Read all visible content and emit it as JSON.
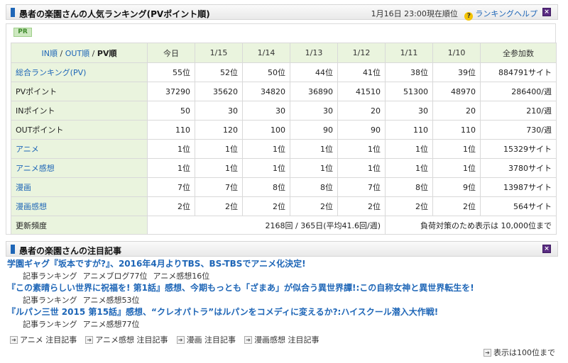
{
  "ranking_panel": {
    "title": "愚者の楽園さんの人気ランキング(PVポイント順)",
    "as_of": "1月16日 23:00現在順位",
    "help_label": "ランキングヘルプ",
    "close_glyph": "×",
    "help_glyph": "?",
    "pr_label": "PR"
  },
  "table": {
    "sort_in": "IN順",
    "sort_out": "OUT順",
    "sort_pv": "PV順",
    "sep": "/",
    "columns": [
      "今日",
      "1/15",
      "1/14",
      "1/13",
      "1/12",
      "1/11",
      "1/10",
      "全参加数"
    ],
    "rows": [
      {
        "label": "総合ランキング(PV)",
        "values": [
          "55位",
          "52位",
          "50位",
          "44位",
          "41位",
          "38位",
          "39位",
          "884791サイト"
        ]
      },
      {
        "label": "PVポイント",
        "values": [
          "37290",
          "35620",
          "34820",
          "36890",
          "41510",
          "51300",
          "48970",
          "286400/週"
        ]
      },
      {
        "label": "INポイント",
        "values": [
          "50",
          "30",
          "30",
          "30",
          "20",
          "30",
          "20",
          "210/週"
        ]
      },
      {
        "label": "OUTポイント",
        "values": [
          "110",
          "120",
          "100",
          "90",
          "90",
          "110",
          "110",
          "730/週"
        ]
      },
      {
        "label": "アニメ",
        "values": [
          "1位",
          "1位",
          "1位",
          "1位",
          "1位",
          "1位",
          "1位",
          "15329サイト"
        ]
      },
      {
        "label": "アニメ感想",
        "values": [
          "1位",
          "1位",
          "1位",
          "1位",
          "1位",
          "1位",
          "1位",
          "3780サイト"
        ]
      },
      {
        "label": "漫画",
        "values": [
          "7位",
          "7位",
          "8位",
          "8位",
          "7位",
          "8位",
          "9位",
          "13987サイト"
        ]
      },
      {
        "label": "漫画感想",
        "values": [
          "2位",
          "2位",
          "2位",
          "2位",
          "2位",
          "2位",
          "2位",
          "564サイト"
        ]
      }
    ],
    "update_label": "更新頻度",
    "update_value": "2168回 / 365日(平均41.6回/週)",
    "load_note": "負荷対策のため表示は 10,000位まで"
  },
  "hot_panel": {
    "title": "愚者の楽園さんの注目記事",
    "close_glyph": "×"
  },
  "articles": [
    {
      "title": "学園ギャグ『坂本ですが?』、2016年4月よりTBS、BS-TBSでアニメ化決定!",
      "meta": [
        "記事ランキング",
        "アニメブログ77位",
        "アニメ感想16位"
      ]
    },
    {
      "title": "『この素晴らしい世界に祝福を! 第1話』感想、今期もっとも「ざまあ」が似合う異世界譚!:この自称女神と異世界転生を!",
      "meta": [
        "記事ランキング",
        "アニメ感想53位"
      ]
    },
    {
      "title": "『ルパン三世 2015 第15話』感想、“クレオパトラ”はルパンをコメディに変えるか?:ハイスクール潜入大作戦!",
      "meta": [
        "記事ランキング",
        "アニメ感想77位"
      ]
    }
  ],
  "category_links": [
    "アニメ 注目記事",
    "アニメ感想 注目記事",
    "漫画 注目記事",
    "漫画感想 注目記事"
  ],
  "more_label": "表示は100位まで",
  "arrow_glyph": "➜",
  "colors": {
    "link": "#1e66b7",
    "header_cell_bg": "#eaf4de",
    "close_box": "#5a2c82",
    "section_bar": "#1e66b7"
  }
}
